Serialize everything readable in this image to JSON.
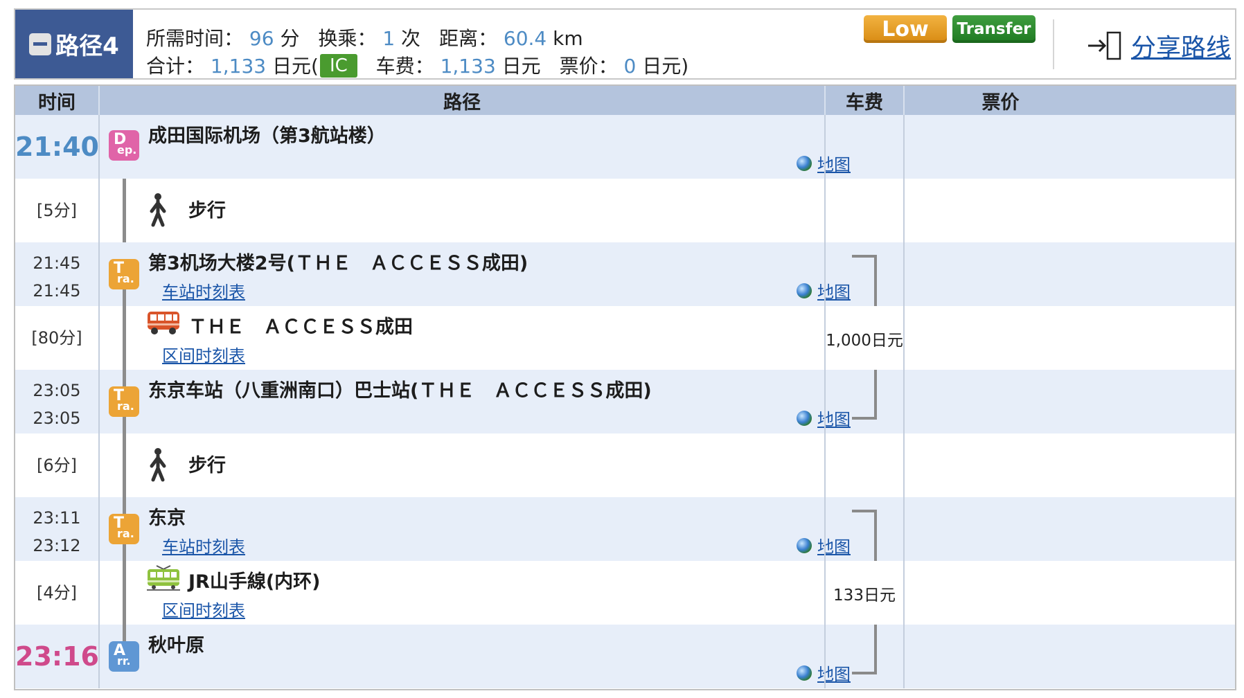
{
  "summary": {
    "route_label": "路径4",
    "time_label": "所需时间：",
    "time_value": "96",
    "time_unit": "分",
    "transfer_label": "换乘：",
    "transfer_value": "1",
    "transfer_unit": "次",
    "distance_label": "距离：",
    "distance_value": "60.4",
    "distance_unit": "km",
    "total_label": "合计：",
    "total_value": "1,133",
    "total_unit_open": "日元(",
    "ic_label": "IC",
    "fare_label": "车费：",
    "fare_value": "1,133",
    "fare_unit": "日元",
    "ticket_label": "票价：",
    "ticket_value": "0",
    "ticket_unit_close": "日元)",
    "badges": {
      "low": "Low",
      "transfer": "Transfer"
    },
    "share_label": "分享路线"
  },
  "table": {
    "headers": {
      "time": "时间",
      "route": "路径",
      "fare": "车费",
      "ticket": "票价"
    },
    "map_label": "地图",
    "station_timetable_label": "车站时刻表",
    "section_timetable_label": "区间时刻表",
    "rows": [
      {
        "type": "station",
        "kind": "dep",
        "icon_l1": "D",
        "icon_l2": "ep.",
        "time": "21:40",
        "name": "成田国际机场（第3航站楼）"
      },
      {
        "type": "leg",
        "mode": "walk",
        "duration": "[5分]",
        "name": "步行"
      },
      {
        "type": "station",
        "kind": "tra",
        "icon_l1": "T",
        "icon_l2": "ra.",
        "time_arr": "21:45",
        "time_dep": "21:45",
        "name": "第3机场大楼2号(ＴＨＥ　ＡＣＣＥＳＳ成田)"
      },
      {
        "type": "leg",
        "mode": "bus",
        "duration": "[80分]",
        "name": "ＴＨＥ　ＡＣＣＥＳＳ成田",
        "fare": "1,000日元"
      },
      {
        "type": "station",
        "kind": "tra",
        "icon_l1": "T",
        "icon_l2": "ra.",
        "time_arr": "23:05",
        "time_dep": "23:05",
        "name": "东京车站（八重洲南口）巴士站(ＴＨＥ　ＡＣＣＥＳＳ成田)"
      },
      {
        "type": "leg",
        "mode": "walk",
        "duration": "[6分]",
        "name": "步行"
      },
      {
        "type": "station",
        "kind": "tra",
        "icon_l1": "T",
        "icon_l2": "ra.",
        "time_arr": "23:11",
        "time_dep": "23:12",
        "name": "东京"
      },
      {
        "type": "leg",
        "mode": "train",
        "duration": "[4分]",
        "name": "JR山手線(内环)",
        "fare": "133日元"
      },
      {
        "type": "station",
        "kind": "arr",
        "icon_l1": "A",
        "icon_l2": "rr.",
        "time": "23:16",
        "name": "秋叶原"
      }
    ]
  },
  "colors": {
    "header_blue": "#3d5a94",
    "table_header": "#b4c4dd",
    "station_row": "#e7eef9",
    "value_blue": "#4d8bc4",
    "arrival_pink": "#cf4a8b",
    "ic_green": "#4a9b2f",
    "low_orange": "#d88a12",
    "transfer_green": "#1f7a22"
  },
  "icons": {
    "collapse": "minus-square-icon",
    "share": "share-enter-icon",
    "map": "globe-icon",
    "walk": "walking-person-icon",
    "bus": "bus-icon",
    "train": "train-icon"
  }
}
